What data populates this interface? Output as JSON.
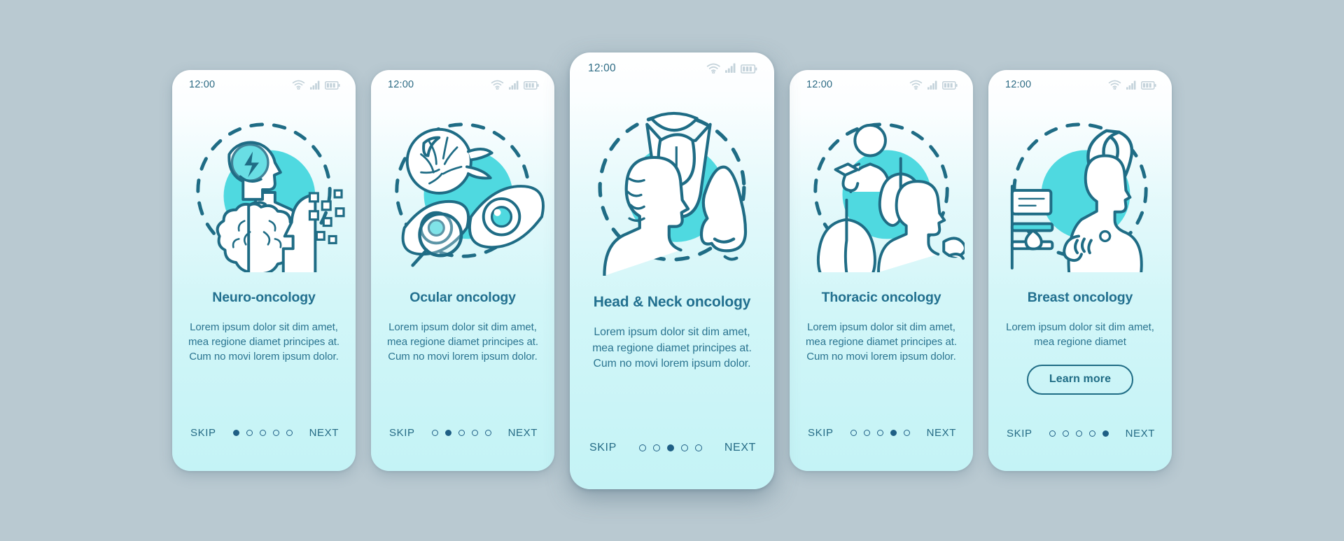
{
  "meta": {
    "background_color": "#b9c9d1",
    "card_gradient_top": "#ffffff",
    "card_gradient_bottom": "#c4f3f6",
    "accent_line_color": "#1f6c85",
    "accent_fill_color": "#4fd9e0",
    "title_color": "#22708f",
    "body_color": "#2a7490"
  },
  "statusbar": {
    "time": "12:00",
    "icons": [
      "wifi-icon",
      "cellular-signal-icon",
      "battery-icon"
    ]
  },
  "nav": {
    "skip_label": "SKIP",
    "next_label": "NEXT",
    "total_dots": 5
  },
  "screens": [
    {
      "id": "neuro-oncology",
      "featured": false,
      "illustration": "neuro-oncology-illustration",
      "title": "Neuro-oncology",
      "description": "Lorem ipsum dolor sit dim amet, mea regione diamet principes at. Cum no movi lorem ipsum dolor.",
      "active_dot": 1,
      "has_learn_more": false,
      "learn_more_label": ""
    },
    {
      "id": "ocular-oncology",
      "featured": false,
      "illustration": "ocular-oncology-illustration",
      "title": "Ocular oncology",
      "description": "Lorem ipsum dolor sit dim amet, mea regione diamet principes at. Cum no movi lorem ipsum dolor.",
      "active_dot": 2,
      "has_learn_more": false,
      "learn_more_label": ""
    },
    {
      "id": "head-neck-oncology",
      "featured": true,
      "illustration": "head-neck-oncology-illustration",
      "title": "Head & Neck oncology",
      "description": "Lorem ipsum dolor sit dim amet, mea regione diamet principes at. Cum no movi lorem ipsum dolor.",
      "active_dot": 3,
      "has_learn_more": false,
      "learn_more_label": ""
    },
    {
      "id": "thoracic-oncology",
      "featured": false,
      "illustration": "thoracic-oncology-illustration",
      "title": "Thoracic oncology",
      "description": "Lorem ipsum dolor sit dim amet, mea regione diamet principes at. Cum no movi lorem ipsum dolor.",
      "active_dot": 4,
      "has_learn_more": false,
      "learn_more_label": ""
    },
    {
      "id": "breast-oncology",
      "featured": false,
      "illustration": "breast-oncology-illustration",
      "title": "Breast oncology",
      "description": "Lorem ipsum dolor sit dim amet, mea regione diamet",
      "active_dot": 5,
      "has_learn_more": true,
      "learn_more_label": "Learn more"
    }
  ]
}
